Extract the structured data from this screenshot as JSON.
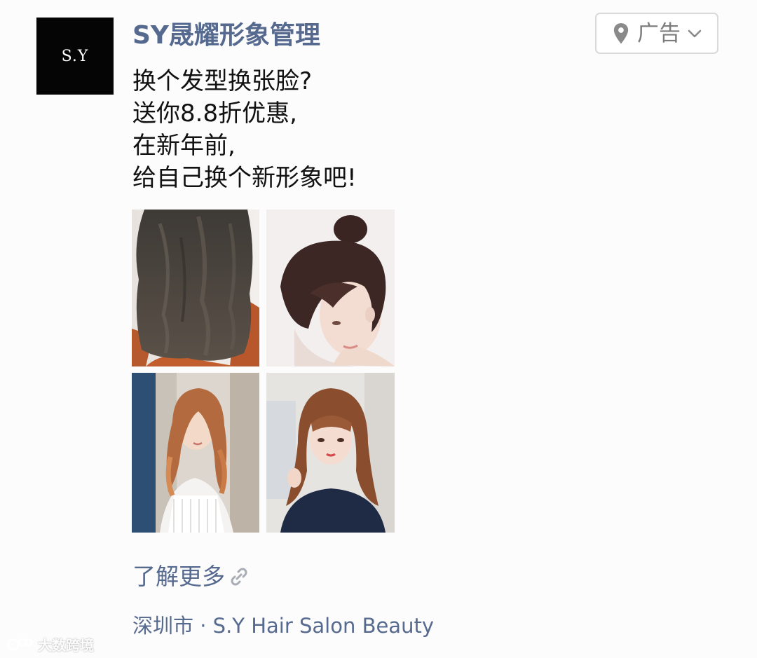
{
  "avatar": {
    "text": "S.Y"
  },
  "account": {
    "name": "SY晟耀形象管理"
  },
  "ad_tag": {
    "icon": "location-pin-icon",
    "label": "广告",
    "chevron": "chevron-down-icon"
  },
  "body_lines": [
    "换个发型换张脸?",
    "送你8.8折优惠,",
    "在新年前,",
    "给自己换个新形象吧!"
  ],
  "photos": [
    {
      "subject": "long wavy dark hair, back view"
    },
    {
      "subject": "woman with hair bun and bangs"
    },
    {
      "subject": "woman with long curly auburn hair"
    },
    {
      "subject": "woman with bangs and wavy brown hair"
    }
  ],
  "cta": {
    "label": "了解更多",
    "icon": "link-icon"
  },
  "location": {
    "text": "深圳市 · S.Y Hair Salon Beauty"
  },
  "watermark": {
    "text": "大数跨境"
  },
  "colors": {
    "link": "#56698f",
    "body_text": "#111111",
    "avatar_bg": "#050505",
    "ad_tag_border": "#d9d9d9"
  }
}
